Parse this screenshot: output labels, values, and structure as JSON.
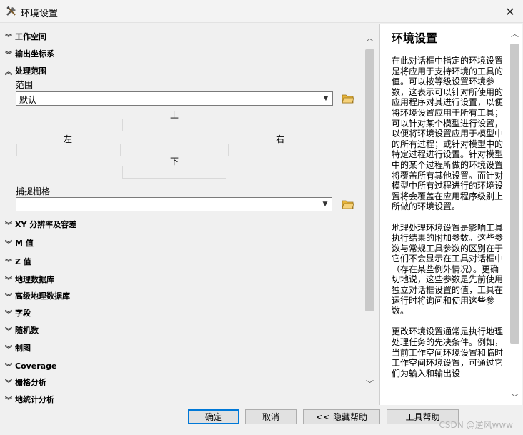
{
  "window": {
    "title": "环境设置",
    "close_glyph": "✕",
    "icon": "tools-icon"
  },
  "sections_top": [
    {
      "label": "工作空间",
      "expanded": false
    },
    {
      "label": "输出坐标系",
      "expanded": false
    },
    {
      "label": "处理范围",
      "expanded": true
    }
  ],
  "processing_extent": {
    "extent_label": "范围",
    "extent_value": "默认",
    "top_label": "上",
    "left_label": "左",
    "right_label": "右",
    "bottom_label": "下",
    "snap_raster_label": "捕捉栅格",
    "snap_raster_value": ""
  },
  "sections_bottom": [
    {
      "label": "XY 分辨率及容差"
    },
    {
      "label": "M 值"
    },
    {
      "label": "Z 值"
    },
    {
      "label": "地理数据库"
    },
    {
      "label": "高级地理数据库"
    },
    {
      "label": "字段"
    },
    {
      "label": "随机数"
    },
    {
      "label": "制图"
    },
    {
      "label": "Coverage"
    },
    {
      "label": "栅格分析"
    },
    {
      "label": "地统计分析"
    }
  ],
  "help": {
    "title": "环境设置",
    "paragraphs": [
      "在此对话框中指定的环境设置是将应用于支持环境的工具的值。可以按等级设置环境参数，这表示可以针对所使用的应用程序对其进行设置，以便将环境设置应用于所有工具；可以针对某个模型进行设置，以便将环境设置应用于模型中的所有过程；或针对模型中的特定过程进行设置。针对模型中的某个过程所做的环境设置将覆盖所有其他设置。而针对模型中所有过程进行的环境设置将会覆盖在应用程序级别上所做的环境设置。",
      "地理处理环境设置是影响工具执行结果的附加参数。这些参数与常规工具参数的区别在于它们不会显示在工具对话框中（存在某些例外情况）。更确切地说，这些参数是先前使用独立对话框设置的值，工具在运行时将询问和使用这些参数。",
      "更改环境设置通常是执行地理处理任务的先决条件。例如，当前工作空间环境设置和临时工作空间环境设置，可通过它们为输入和输出设"
    ]
  },
  "buttons": {
    "ok": "确定",
    "cancel": "取消",
    "hide_help": "<< 隐藏帮助",
    "tool_help": "工具帮助"
  },
  "watermark": "CSDN @逆风www",
  "colors": {
    "accent": "#0078d7",
    "folder": "#e8b53a"
  }
}
